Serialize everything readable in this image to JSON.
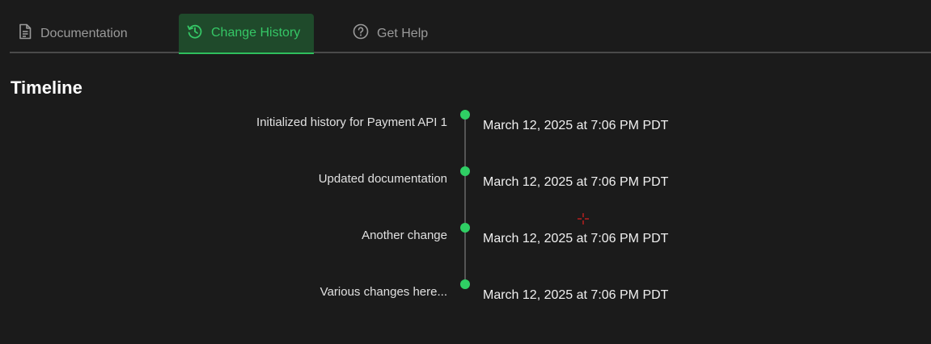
{
  "tabs": [
    {
      "label": "Documentation",
      "icon": "document-icon",
      "active": false
    },
    {
      "label": "Change History",
      "icon": "history-icon",
      "active": true
    },
    {
      "label": "Get Help",
      "icon": "help-icon",
      "active": false
    }
  ],
  "page": {
    "heading": "Timeline"
  },
  "timeline": {
    "events": [
      {
        "label": "Initialized history for Payment API 1",
        "date": "March 12, 2025 at 7:06 PM PDT"
      },
      {
        "label": "Updated documentation",
        "date": "March 12, 2025 at 7:06 PM PDT"
      },
      {
        "label": "Another change",
        "date": "March 12, 2025 at 7:06 PM PDT"
      },
      {
        "label": "Various changes here...",
        "date": "March 12, 2025 at 7:06 PM PDT"
      }
    ]
  },
  "colors": {
    "background": "#1b1b1b",
    "accent": "#2fcf64",
    "active_tab_bg": "#1f4a2b"
  }
}
